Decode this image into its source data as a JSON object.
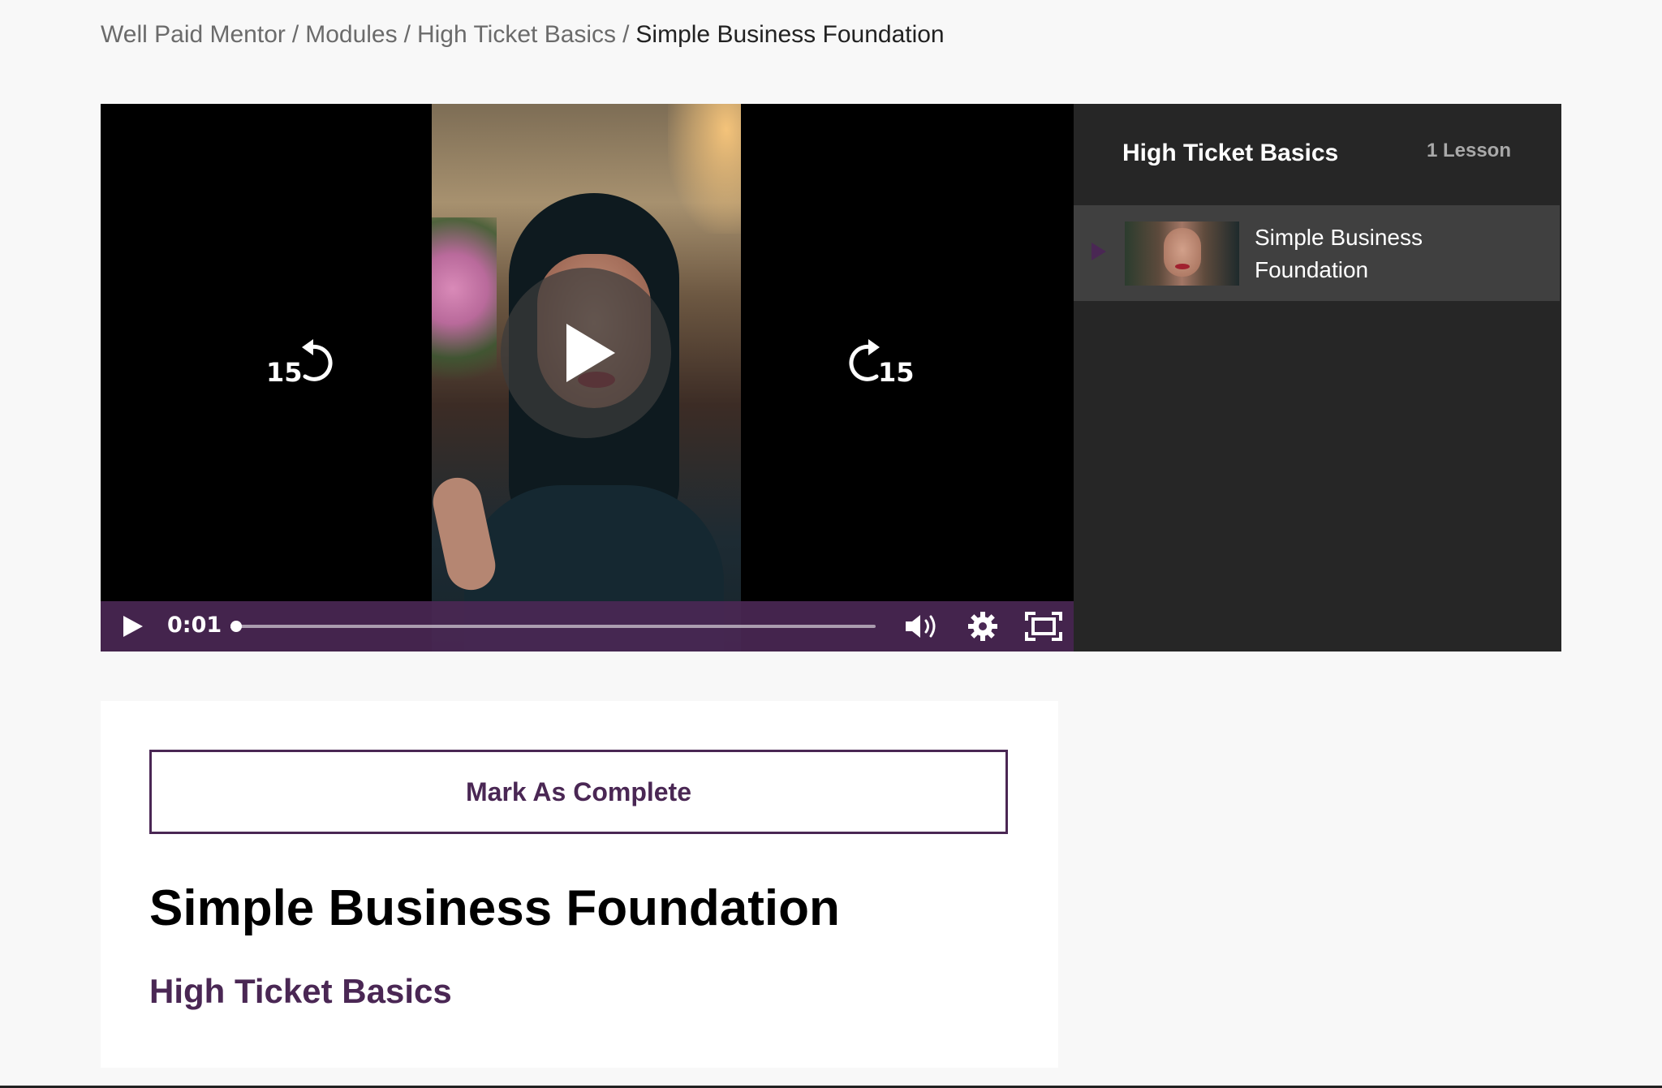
{
  "breadcrumb": {
    "items": [
      "Well Paid Mentor",
      "Modules",
      "High Ticket Basics"
    ],
    "separator": "/",
    "current": "Simple Business Foundation"
  },
  "player": {
    "time": "0:01",
    "progress": 0.005,
    "skip_back_label": "15",
    "skip_forward_label": "15",
    "icons": {
      "center": "play-icon",
      "back": "rewind-15-icon",
      "forward": "forward-15-icon",
      "control_play": "play-icon",
      "volume": "volume-icon",
      "settings": "gear-icon",
      "fullscreen": "fullscreen-icon"
    },
    "controls_color": "#4a2754"
  },
  "playlist": {
    "title": "High Ticket Basics",
    "count": "1 Lesson",
    "lessons": [
      {
        "label": "Simple Business Foundation",
        "active": true
      }
    ]
  },
  "content": {
    "complete_button": "Mark As Complete",
    "lesson_title": "Simple Business Foundation",
    "module_name": "High Ticket Basics"
  },
  "colors": {
    "accent": "#4a2754",
    "panel": "#262626",
    "active_item": "#404040",
    "page_bg": "#f8f8f8"
  }
}
